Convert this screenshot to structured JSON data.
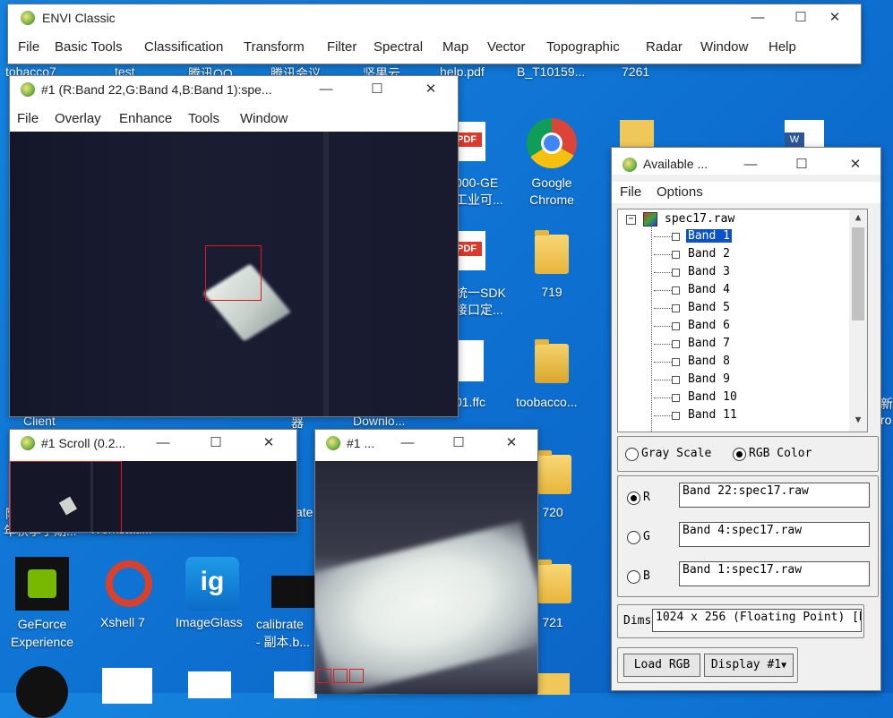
{
  "desktop": {
    "row_partial_labels": [
      "tobacco7",
      "test",
      "腾讯QQ",
      "腾讯会议",
      "坚果云",
      "help.pdf",
      "B_T10159...",
      "7261"
    ],
    "icons": [
      {
        "label": "000-GE\n工业可...",
        "type": "pdf"
      },
      {
        "label": "Google\nChrome",
        "type": "chrome"
      },
      {
        "label": "统一SDK\n接口定...",
        "type": "pdf"
      },
      {
        "label": "719",
        "type": "folder"
      },
      {
        "label": "01.ffc",
        "type": "file"
      },
      {
        "label": "toobacco...",
        "type": "file"
      },
      {
        "label": "720",
        "type": "folder"
      },
      {
        "label": "721",
        "type": "folder"
      },
      {
        "label": "GeForce\nExperience",
        "type": "app"
      },
      {
        "label": "Xshell 7",
        "type": "app"
      },
      {
        "label": "ImageGlass",
        "type": "app"
      },
      {
        "label": "calibrate\n- 副本.b...",
        "type": "file"
      },
      {
        "label": "Client",
        "type": "partial"
      },
      {
        "label": "器",
        "type": "partial"
      },
      {
        "label": "Downlo...",
        "type": "partial"
      },
      {
        "label": "ate",
        "type": "partial"
      },
      {
        "label": "年秋季学期...",
        "type": "partial"
      },
      {
        "label": "Workstati...",
        "type": "partial"
      },
      {
        "label": "新",
        "type": "partial"
      },
      {
        "label": "ro",
        "type": "partial"
      }
    ],
    "partial_prefix": "阿"
  },
  "envi_main": {
    "title": "ENVI Classic",
    "menu": [
      "File",
      "Basic Tools",
      "Classification",
      "Transform",
      "Filter",
      "Spectral",
      "Map",
      "Vector",
      "Topographic",
      "Radar",
      "Window",
      "Help"
    ]
  },
  "image_window": {
    "title": "#1 (R:Band 22,G:Band 4,B:Band 1):spe...",
    "menu": [
      "File",
      "Overlay",
      "Enhance",
      "Tools",
      "Window"
    ]
  },
  "scroll_window": {
    "title": "#1 Scroll (0.2..."
  },
  "zoom_window": {
    "title": "#1 ..."
  },
  "available_bands": {
    "title": "Available ...",
    "menu": [
      "File",
      "Options"
    ],
    "file_name": "spec17.raw",
    "bands": [
      "Band 1",
      "Band 2",
      "Band 3",
      "Band 4",
      "Band 5",
      "Band 6",
      "Band 7",
      "Band 8",
      "Band 9",
      "Band 10",
      "Band 11"
    ],
    "selected_band": "Band 1",
    "mode_gray": "Gray Scale",
    "mode_rgb": "RGB Color",
    "mode_selected": "RGB Color",
    "r_label": "R",
    "g_label": "G",
    "b_label": "B",
    "r_value": "Band 22:spec17.raw",
    "g_value": "Band 4:spec17.raw",
    "b_value": "Band 1:spec17.raw",
    "dims_label": "Dims",
    "dims_value": "1024 x 256 (Floating Point) [B",
    "load_button": "Load RGB",
    "display_button": "Display #1"
  },
  "window_controls": {
    "minimize": "—",
    "maximize": "☐",
    "close": "✕"
  }
}
